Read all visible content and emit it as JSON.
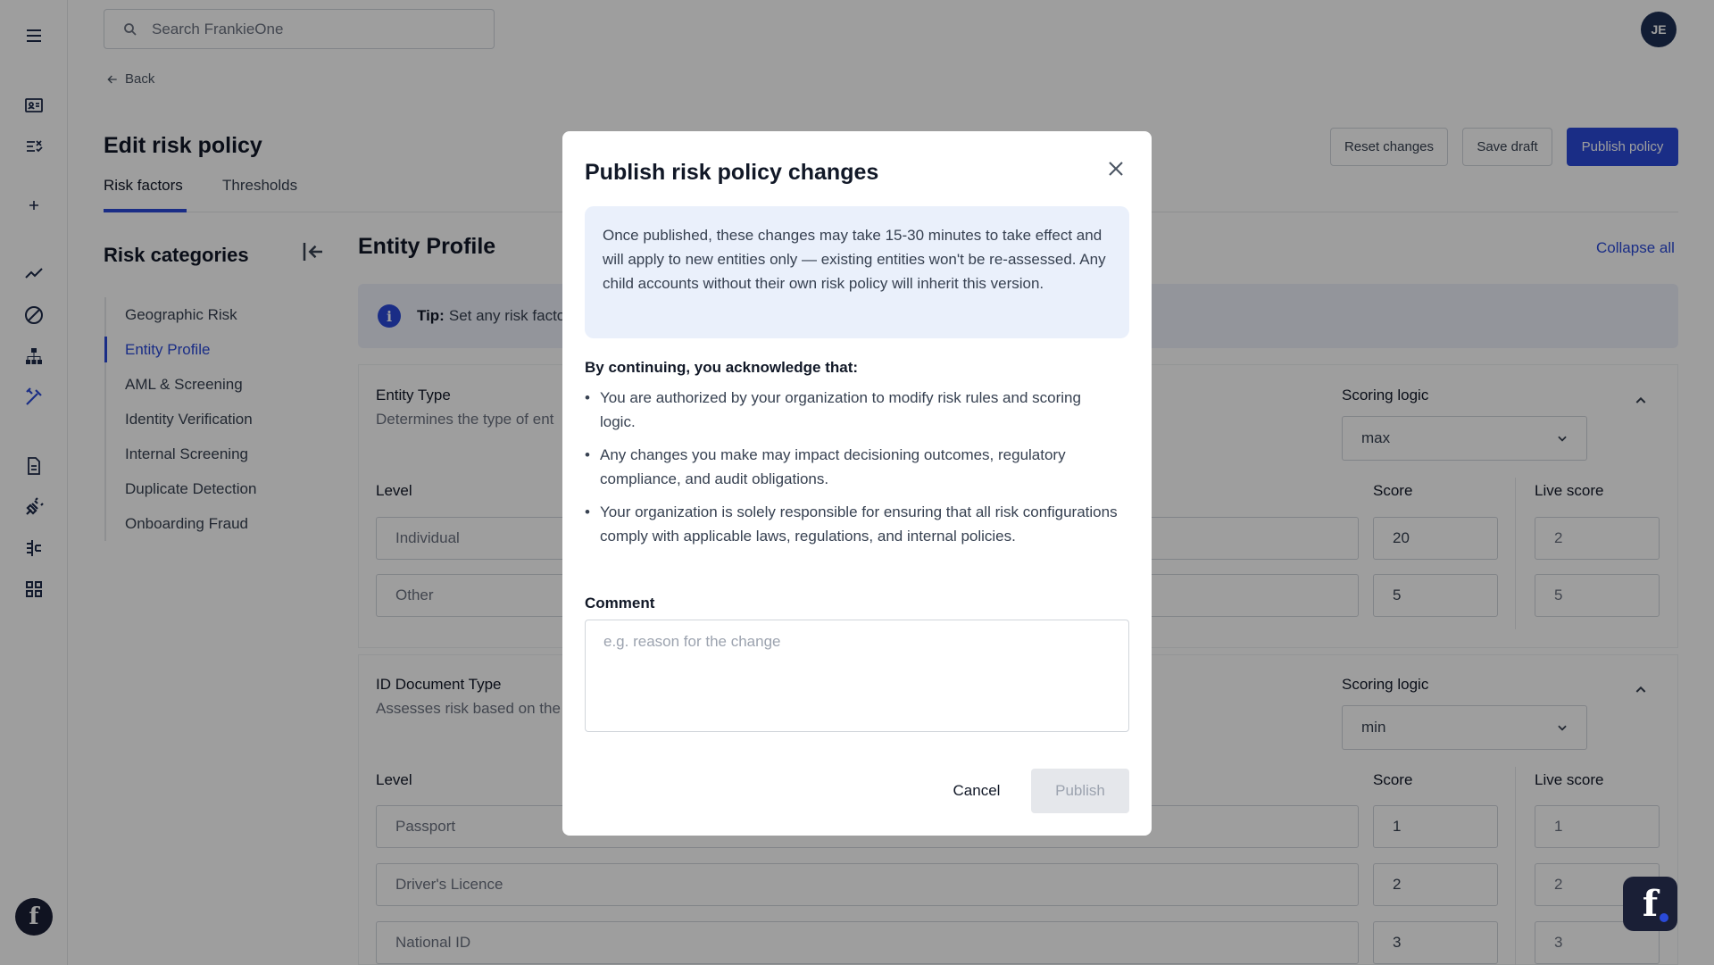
{
  "search": {
    "placeholder": "Search FrankieOne"
  },
  "user": {
    "initials": "JE"
  },
  "nav": {
    "back_label": "Back"
  },
  "page": {
    "title": "Edit risk policy",
    "tabs": [
      {
        "label": "Risk factors"
      },
      {
        "label": "Thresholds"
      }
    ],
    "actions": {
      "reset": "Reset changes",
      "save": "Save draft",
      "publish": "Publish policy"
    }
  },
  "categories": {
    "title": "Risk categories",
    "items": [
      {
        "label": "Geographic Risk"
      },
      {
        "label": "Entity Profile"
      },
      {
        "label": "AML & Screening"
      },
      {
        "label": "Identity Verification"
      },
      {
        "label": "Internal Screening"
      },
      {
        "label": "Duplicate Detection"
      },
      {
        "label": "Onboarding Fraud"
      }
    ]
  },
  "main": {
    "title": "Entity Profile",
    "collapse_all": "Collapse all",
    "tip": {
      "prefix": "Tip:",
      "text": "Set any risk facto"
    },
    "entity_type": {
      "label": "Entity Type",
      "description": "Determines the type of ent",
      "scoring_label": "Scoring logic",
      "scoring_value": "max",
      "level_header": "Level",
      "score_header": "Score",
      "live_header": "Live score",
      "rows": [
        {
          "level": "Individual",
          "score": "20",
          "live": "2"
        },
        {
          "level": "Other",
          "score": "5",
          "live": "5"
        }
      ]
    },
    "id_document": {
      "label": "ID Document Type",
      "description": "Assesses risk based on the",
      "scoring_label": "Scoring logic",
      "scoring_value": "min",
      "level_header": "Level",
      "score_header": "Score",
      "live_header": "Live score",
      "rows": [
        {
          "level": "Passport",
          "score": "1",
          "live": "1"
        },
        {
          "level": "Driver's Licence",
          "score": "2",
          "live": "2"
        },
        {
          "level": "National ID",
          "score": "3",
          "live": "3"
        }
      ]
    }
  },
  "modal": {
    "title": "Publish risk policy changes",
    "notice": "Once published, these changes may take 15-30 minutes to take effect and will apply to new entities only — existing entities won't be re-assessed. Any child accounts without their own risk policy will inherit this version.",
    "ack_heading": "By continuing, you acknowledge that:",
    "bullets": [
      "You are authorized by your organization to modify risk rules and scoring logic.",
      "Any changes you make may impact decisioning outcomes, regulatory compliance, and audit obligations.",
      "Your organization is solely responsible for ensuring that all risk configurations comply with applicable laws, regulations, and internal policies."
    ],
    "comment_label": "Comment",
    "comment_placeholder": "e.g. reason for the change",
    "cancel": "Cancel",
    "publish": "Publish"
  },
  "colors": {
    "primary": "#2a4ad8",
    "navy": "#1a1f36",
    "notice_bg": "#eaf0fb"
  },
  "icons": [
    "menu-icon",
    "id-card-icon",
    "checklist-icon",
    "plus-icon",
    "trend-icon",
    "block-icon",
    "hierarchy-icon",
    "tools-icon",
    "document-icon",
    "plug-icon",
    "sliders-icon",
    "grid-icon",
    "search-icon",
    "close-icon",
    "chevron-down-icon",
    "chevron-up-icon",
    "arrow-left-icon",
    "info-icon"
  ]
}
